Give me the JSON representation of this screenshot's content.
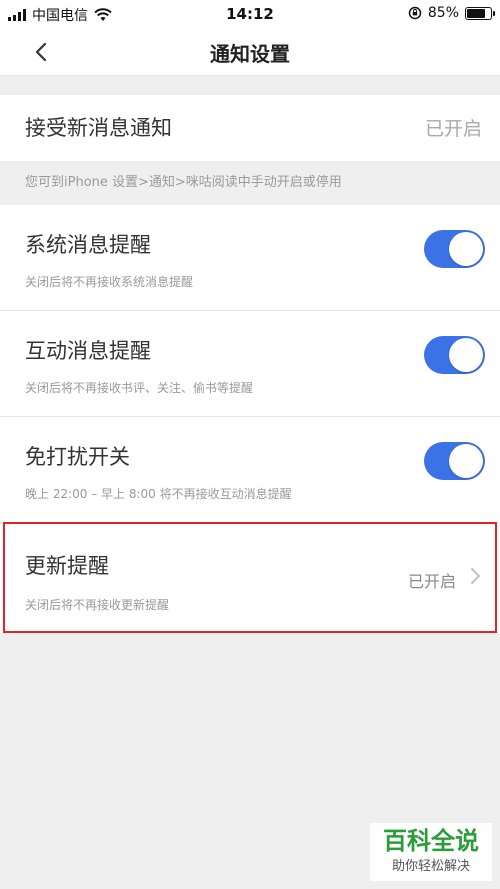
{
  "status_bar": {
    "carrier": "中国电信",
    "time": "14:12",
    "battery_percent_label": "85%",
    "battery_level": 0.85,
    "icons": [
      "signal-icon",
      "wifi-icon",
      "orientation-lock-icon",
      "battery-icon"
    ]
  },
  "nav": {
    "title": "通知设置",
    "back_icon": "chevron-left-icon"
  },
  "receive_notifications": {
    "label": "接受新消息通知",
    "value": "已开启"
  },
  "hint": "您可到iPhone 设置>通知>咪咕阅读中手动开启或停用",
  "settings": [
    {
      "title": "系统消息提醒",
      "subtitle": "关闭后将不再接收系统消息提醒",
      "enabled": true
    },
    {
      "title": "互动消息提醒",
      "subtitle": "关闭后将不再接收书评、关注、偷书等提醒",
      "enabled": true
    },
    {
      "title": "免打扰开关",
      "subtitle": "晚上 22:00 – 早上 8:00 将不再接收互动消息提醒",
      "enabled": true
    }
  ],
  "update_reminder": {
    "title": "更新提醒",
    "subtitle": "关闭后将不再接收更新提醒",
    "value": "已开启",
    "icon": "chevron-right-icon"
  },
  "colors": {
    "toggle_on": "#3b72e6",
    "highlight_border": "#e02525",
    "watermark_green": "#2a9d3a"
  },
  "watermark": {
    "main": "百科全说",
    "sub": "助你轻松解决"
  }
}
